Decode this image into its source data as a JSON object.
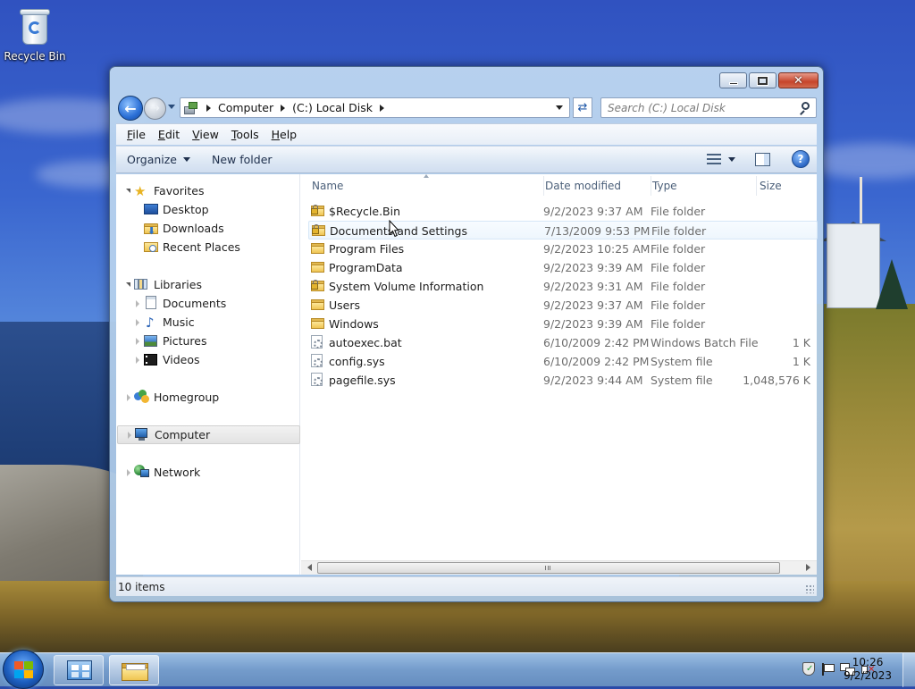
{
  "desktop": {
    "icons": [
      {
        "label": "Recycle Bin",
        "icon": "recycle-bin-icon"
      }
    ]
  },
  "window": {
    "caption_buttons": [
      "minimize",
      "maximize",
      "close"
    ],
    "address": {
      "crumbs": [
        "Computer",
        "(C:) Local Disk"
      ],
      "search_placeholder": "Search (C:) Local Disk"
    },
    "menu": [
      {
        "label": "File",
        "accel": "F"
      },
      {
        "label": "Edit",
        "accel": "E"
      },
      {
        "label": "View",
        "accel": "V"
      },
      {
        "label": "Tools",
        "accel": "T"
      },
      {
        "label": "Help",
        "accel": "H"
      }
    ],
    "toolbar": {
      "organize": "Organize",
      "new_folder": "New folder"
    },
    "nav": {
      "favorites": {
        "label": "Favorites",
        "items": [
          "Desktop",
          "Downloads",
          "Recent Places"
        ]
      },
      "libraries": {
        "label": "Libraries",
        "items": [
          "Documents",
          "Music",
          "Pictures",
          "Videos"
        ]
      },
      "homegroup": "Homegroup",
      "computer": "Computer",
      "network": "Network"
    },
    "columns": {
      "name": "Name",
      "date": "Date modified",
      "type": "Type",
      "size": "Size"
    },
    "files": [
      {
        "name": "$Recycle.Bin",
        "date": "9/2/2023 9:37 AM",
        "type": "File folder",
        "size": "",
        "icon": "locked-folder-icon"
      },
      {
        "name": "Documents and Settings",
        "date": "7/13/2009 9:53 PM",
        "type": "File folder",
        "size": "",
        "icon": "locked-folder-icon"
      },
      {
        "name": "Program Files",
        "date": "9/2/2023 10:25 AM",
        "type": "File folder",
        "size": "",
        "icon": "folder-icon"
      },
      {
        "name": "ProgramData",
        "date": "9/2/2023 9:39 AM",
        "type": "File folder",
        "size": "",
        "icon": "folder-icon"
      },
      {
        "name": "System Volume Information",
        "date": "9/2/2023 9:31 AM",
        "type": "File folder",
        "size": "",
        "icon": "locked-folder-icon"
      },
      {
        "name": "Users",
        "date": "9/2/2023 9:37 AM",
        "type": "File folder",
        "size": "",
        "icon": "folder-icon"
      },
      {
        "name": "Windows",
        "date": "9/2/2023 9:39 AM",
        "type": "File folder",
        "size": "",
        "icon": "folder-icon"
      },
      {
        "name": "autoexec.bat",
        "date": "6/10/2009 2:42 PM",
        "type": "Windows Batch File",
        "size": "1 K",
        "icon": "batch-file-icon"
      },
      {
        "name": "config.sys",
        "date": "6/10/2009 2:42 PM",
        "type": "System file",
        "size": "1 K",
        "icon": "system-file-icon"
      },
      {
        "name": "pagefile.sys",
        "date": "9/2/2023 9:44 AM",
        "type": "System file",
        "size": "1,048,576 K",
        "icon": "system-file-icon"
      }
    ],
    "status": "10 items"
  },
  "taskbar": {
    "clock_time": "10:26",
    "clock_date": "9/2/2023",
    "pinned": [
      "control-panel-icon",
      "windows-explorer-icon"
    ],
    "tray": [
      "action-center-icon",
      "flag-icon",
      "network-icon",
      "volume-muted-icon"
    ]
  },
  "colors": {
    "titlebar": "#b6d1ec",
    "close_button": "#c6452b",
    "selection": "#e3e3e3",
    "taskbar": "#7ba3cf"
  }
}
